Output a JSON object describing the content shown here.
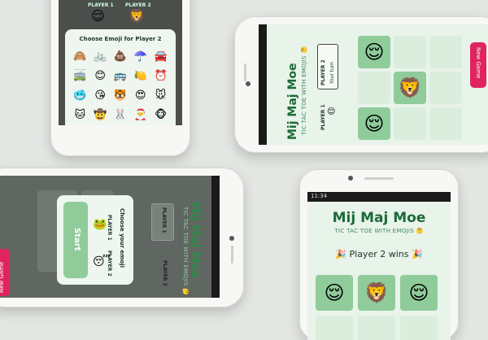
{
  "app": {
    "title": "Mij Maj Moe",
    "subtitle": "TIC TAC TOE WITH EMOJIS 🤔",
    "player1": "PLAYER 1",
    "player2": "PLAYER 2",
    "your_turn": "Your turn",
    "new_game": "New Game",
    "choose_emoji_title": "Choose Emoji for Player 2",
    "choose_your_emoji": "Choose your emoji",
    "start": "Start",
    "win_text": "Player 2 wins",
    "status_time": "11:34"
  },
  "icons": {
    "party": "🎉",
    "smile": "😊",
    "lion": "🦁",
    "relieved": "😌",
    "cool": "😎",
    "frog": "🐸",
    "sleep": "😴",
    "refresh": "⟳"
  },
  "emoji_picker": [
    "🙈",
    "🚲",
    "💩",
    "☂️",
    "🚘",
    "🚎",
    "😊",
    "🚌",
    "🍋",
    "⏰",
    "🥶",
    "😘",
    "🐯",
    "😍",
    "🐭",
    "🐱",
    "🤠",
    "🐰",
    "🎅",
    "🐵"
  ],
  "colors": {
    "accent": "#1c6a38",
    "cell": "#dbeedd",
    "cell_selected": "#8fcc9a",
    "new_game": "#e0245e"
  }
}
